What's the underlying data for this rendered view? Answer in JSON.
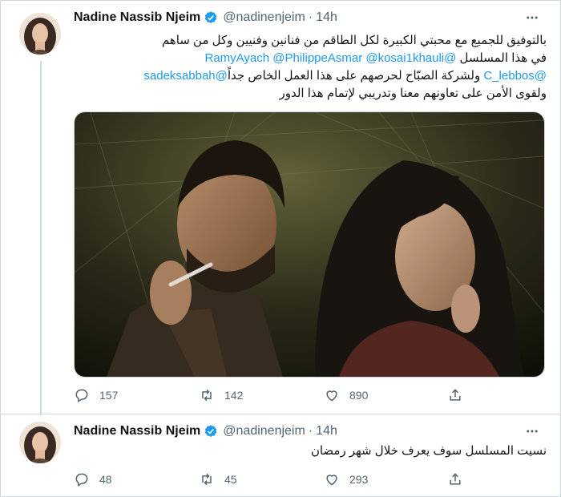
{
  "tweets": [
    {
      "author": {
        "name": "Nadine Nassib Njeim",
        "handle": "@nadinenjeim",
        "time": "14h"
      },
      "lines": [
        {
          "parts": [
            {
              "text": "بالتوفيق للجميع مع محبتي الكبيرة لكل الطاقم من فنانين وفنيين وكل من ساهم"
            }
          ]
        },
        {
          "parts": [
            {
              "text": "في هذا المسلسل "
            },
            {
              "text": "@RamyAyach",
              "mention": true
            },
            {
              "text": " "
            },
            {
              "text": "@PhilippeAsmar",
              "mention": true
            },
            {
              "text": " "
            },
            {
              "text": "@kosai1khauli",
              "mention": true
            }
          ]
        },
        {
          "parts": [
            {
              "text": "@C_lebbos",
              "mention": true
            },
            {
              "text": " ولشركة الصبّاح لحرصهم على هذا العمل الخاص جداً"
            },
            {
              "text": "@sadeksabbah",
              "mention": true
            }
          ]
        },
        {
          "parts": [
            {
              "text": "ولقوى الأمن على تعاونهم معنا وتدريبي لإتمام هذا الدور"
            }
          ]
        }
      ],
      "stats": {
        "replies": "157",
        "retweets": "142",
        "likes": "890"
      }
    },
    {
      "author": {
        "name": "Nadine Nassib Njeim",
        "handle": "@nadinenjeim",
        "time": "14h"
      },
      "lines": [
        {
          "parts": [
            {
              "text": "نسيت المسلسل سوف يعرف خلال شهر رمضان"
            }
          ]
        }
      ],
      "stats": {
        "replies": "48",
        "retweets": "45",
        "likes": "293"
      }
    }
  ],
  "colors": {
    "accent": "#1d9bf0",
    "muted": "#536471",
    "border": "#cfd9de"
  },
  "icons": [
    "verified-badge-icon",
    "more-icon",
    "reply-icon",
    "retweet-icon",
    "like-icon",
    "share-icon"
  ]
}
